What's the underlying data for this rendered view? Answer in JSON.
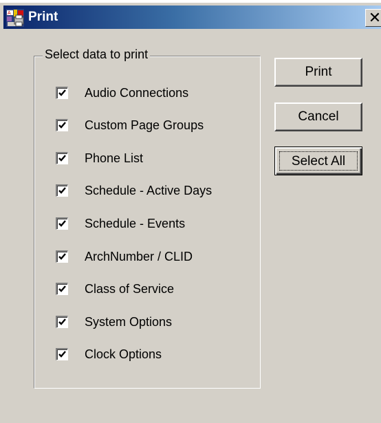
{
  "window": {
    "title": "Print",
    "close_glyph": "✕",
    "icon": "app-printer-icon"
  },
  "group": {
    "legend": "Select data to print",
    "items": [
      {
        "label": "Audio Connections",
        "checked": true
      },
      {
        "label": "Custom Page Groups",
        "checked": true
      },
      {
        "label": "Phone List",
        "checked": true
      },
      {
        "label": "Schedule - Active Days",
        "checked": true
      },
      {
        "label": "Schedule - Events",
        "checked": true
      },
      {
        "label": "ArchNumber / CLID",
        "checked": true
      },
      {
        "label": "Class of Service",
        "checked": true
      },
      {
        "label": "System Options",
        "checked": true
      },
      {
        "label": "Clock Options",
        "checked": true
      }
    ]
  },
  "buttons": {
    "print": "Print",
    "cancel": "Cancel",
    "select_all": "Select All"
  },
  "colors": {
    "face": "#d4d0c8",
    "title_start": "#0a246a",
    "title_end": "#a6caf0"
  }
}
